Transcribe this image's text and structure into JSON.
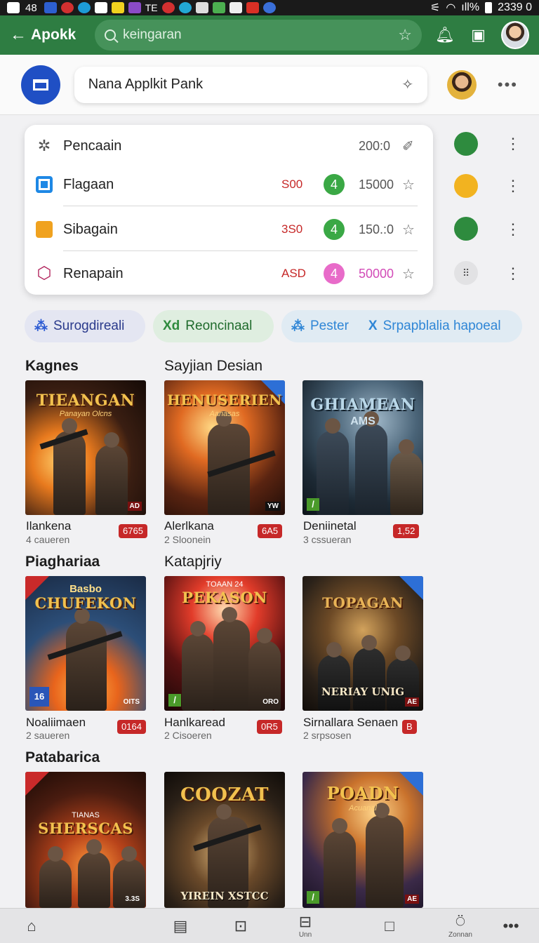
{
  "status_bar": {
    "left_number": "48",
    "tag_text": "TE",
    "battery_text": "ıll%",
    "time": "2339 0"
  },
  "app_bar": {
    "title": "Apokk",
    "search_placeholder": "keingaran"
  },
  "header": {
    "name_field_value": "Nana Applkit Pank"
  },
  "list": [
    {
      "label": "Pencaain",
      "price": "",
      "badge": "",
      "amount": "200:0",
      "status_color": "#2e8b3e"
    },
    {
      "label": "Flagaan",
      "price": "S00",
      "badge": "4",
      "badge_color": "#3aa845",
      "amount": "15000",
      "status_color": "#f2b320"
    },
    {
      "label": "Sibagain",
      "price": "3S0",
      "badge": "4",
      "badge_color": "#3aa845",
      "amount": "150.:0",
      "status_color": "#2e8b3e"
    },
    {
      "label": "Renapain",
      "price": "ASD",
      "badge": "4",
      "badge_color": "#e86bc9",
      "amount": "50000",
      "status_color": "#dedede"
    }
  ],
  "chips": [
    {
      "icon": "⁂",
      "label": "Surogdireali"
    },
    {
      "icon": "Xd",
      "label": "Reoncinaal"
    },
    {
      "icon": "⁂",
      "label": "Pester"
    },
    {
      "icon": "X",
      "label": "Srpapblalia hapoeal"
    }
  ],
  "sections": [
    {
      "title": "Kagnes",
      "subtitle": "Sayjian Desian"
    },
    {
      "title": "Piaghariaa",
      "subtitle": "Katapjriy"
    },
    {
      "title": "Patabarica",
      "subtitle": ""
    }
  ],
  "games": [
    {
      "art_title": "TIEANGAN",
      "art_sub": "Panayan Olcns",
      "name": "Ilankena",
      "meta": "4 caueren",
      "badge": "6765"
    },
    {
      "art_title": "HENUSERIEN",
      "art_sub": "Aanasas",
      "name": "Alerlkana",
      "meta": "2 Sloonein",
      "badge": "6A5"
    },
    {
      "art_title": "GHIAMEAN",
      "art_sub": "AMS",
      "name": "Deniinetal",
      "meta": "3 cssueran",
      "badge": "1,52"
    },
    {
      "art_title": "CHUFEKON",
      "art_sub": "Basbo",
      "name": "Noaliimaen",
      "meta": "2 saueren",
      "badge": "0164"
    },
    {
      "art_title": "PEKASON",
      "art_sub": "TOAAN 24",
      "name": "Hanlkaread",
      "meta": "2 Cisoeren",
      "badge": "0R5"
    },
    {
      "art_title": "TOPAGAN",
      "art_sub": "NERIAY UNIG",
      "name": "Sirnallara Senaen",
      "meta": "2 srpsosen",
      "badge": "B"
    },
    {
      "art_title": "SHERSCAS",
      "art_sub": "TIANAS",
      "name": "",
      "meta": "",
      "badge": ""
    },
    {
      "art_title": "COOZAT",
      "art_sub": "YIREIN XSTCC",
      "name": "",
      "meta": "",
      "badge": ""
    },
    {
      "art_title": "POADN",
      "art_sub": "Acuanal",
      "name": "",
      "meta": "",
      "badge": ""
    }
  ],
  "bottom_nav": [
    {
      "icon": "home-icon",
      "label": ""
    },
    {
      "icon": "list-icon",
      "label": ""
    },
    {
      "icon": "bag-icon",
      "label": ""
    },
    {
      "icon": "briefcase-icon",
      "label": "Unn"
    },
    {
      "icon": "square-icon",
      "label": ""
    },
    {
      "icon": "timer-icon",
      "label": "Zonnan"
    },
    {
      "icon": "more-icon",
      "label": ""
    }
  ]
}
